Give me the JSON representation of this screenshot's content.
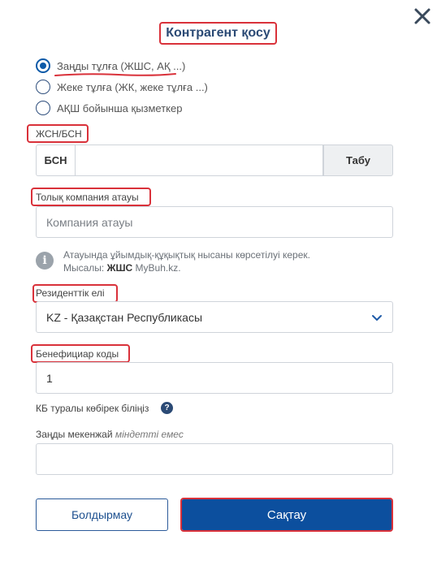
{
  "dialog": {
    "title": "Контрагент қосу"
  },
  "entity_type": {
    "options": [
      {
        "label": "Заңды тұлға (ЖШС, АҚ ...)",
        "checked": true
      },
      {
        "label": "Жеке тұлға (ЖК, жеке тұлға ...)",
        "checked": false
      },
      {
        "label": "АҚШ бойынша қызметкер",
        "checked": false
      }
    ]
  },
  "bin": {
    "label": "ЖСН/БСН",
    "prefix": "БСН",
    "value": "",
    "search_button": "Табу"
  },
  "company_name": {
    "label": "Толық компания атауы",
    "placeholder": "Компания атауы",
    "info_line1": "Атауында ұйымдық-құқықтық нысаны көрсетілуі керек.",
    "info_example_prefix": "Мысалы:",
    "info_example_bold": "ЖШС",
    "info_example_rest": "MyBuh.kz."
  },
  "residency": {
    "label": "Резиденттік елі",
    "selected": "KZ - Қазақстан Республикасы"
  },
  "beneficiary": {
    "label": "Бенефициар коды",
    "value": "1",
    "help_text": "КБ туралы көбірек біліңіз",
    "help_icon": "?"
  },
  "legal_address": {
    "label": "Заңды мекенжай",
    "optional": "міндетті емес",
    "value": ""
  },
  "actions": {
    "cancel": "Болдырмау",
    "save": "Сақтау"
  },
  "colors": {
    "accent": "#0c4f9e",
    "highlight": "#d9313a",
    "title": "#2b4a75"
  }
}
